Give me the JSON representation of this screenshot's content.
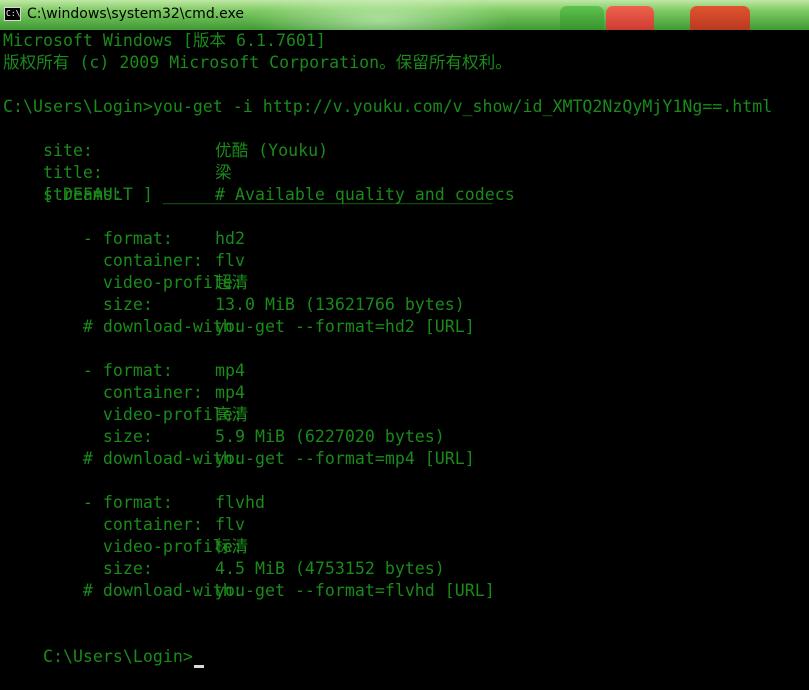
{
  "window": {
    "title": "C:\\windows\\system32\\cmd.exe",
    "icon_text": "C:\\",
    "accent": "#1a8a1a"
  },
  "console": {
    "banner1": "Microsoft Windows [版本 6.1.7601]",
    "banner2": "版权所有 (c) 2009 Microsoft Corporation。保留所有权利。",
    "command": "C:\\Users\\Login>you-get -i http://v.youku.com/v_show/id_XMTQ2NzQyMjY1Ng==.html",
    "site_key": "site:",
    "site_val": "优酷 (Youku)",
    "title_key": "title:",
    "title_val": "梁",
    "streams_key": "streams:",
    "streams_val": "# Available quality and codecs",
    "default_header": "    [ DEFAULT ] _________________________________",
    "s1_format_key": "    - format:",
    "s1_format_val": "hd2",
    "s1_container_key": "      container:",
    "s1_container_val": "flv",
    "s1_profile_key": "      video-profile:",
    "s1_profile_val": "超清",
    "s1_size_key": "      size:",
    "s1_size_val": "13.0 MiB (13621766 bytes)",
    "s1_dl_key": "    # download-with:",
    "s1_dl_val": "you-get --format=hd2 [URL]",
    "s2_format_key": "    - format:",
    "s2_format_val": "mp4",
    "s2_container_key": "      container:",
    "s2_container_val": "mp4",
    "s2_profile_key": "      video-profile:",
    "s2_profile_val": "高清",
    "s2_size_key": "      size:",
    "s2_size_val": "5.9 MiB (6227020 bytes)",
    "s2_dl_key": "    # download-with:",
    "s2_dl_val": "you-get --format=mp4 [URL]",
    "s3_format_key": "    - format:",
    "s3_format_val": "flvhd",
    "s3_container_key": "      container:",
    "s3_container_val": "flv",
    "s3_profile_key": "      video-profile:",
    "s3_profile_val": "标清",
    "s3_size_key": "      size:",
    "s3_size_val": "4.5 MiB (4753152 bytes)",
    "s3_dl_key": "    # download-with:",
    "s3_dl_val": "you-get --format=flvhd [URL]",
    "prompt": "C:\\Users\\Login>"
  }
}
